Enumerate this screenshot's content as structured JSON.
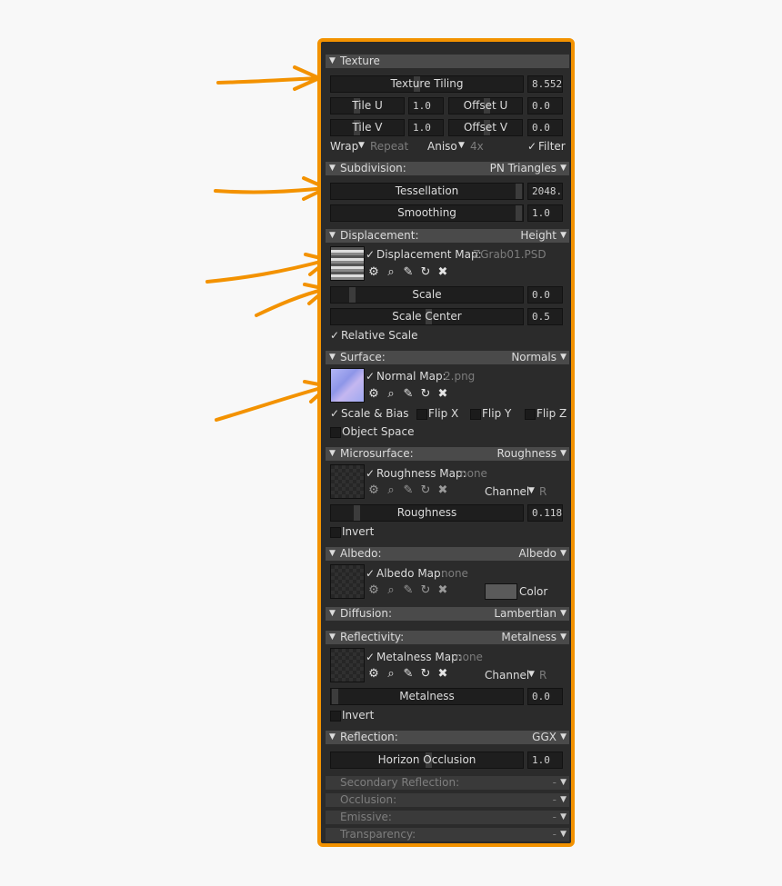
{
  "texture": {
    "header": "Texture",
    "tiling_label": "Texture Tiling",
    "tiling_value": "8.552",
    "tile_u_label": "Tile U",
    "tile_u_value": "1.0",
    "offset_u_label": "Offset U",
    "offset_u_value": "0.0",
    "tile_v_label": "Tile V",
    "tile_v_value": "1.0",
    "offset_v_label": "Offset V",
    "offset_v_value": "0.0",
    "wrap_label": "Wrap",
    "wrap_value": "Repeat",
    "aniso_label": "Aniso",
    "aniso_value": "4x",
    "filter_label": "Filter"
  },
  "subdivision": {
    "header": "Subdivision:",
    "mode": "PN Triangles",
    "tess_label": "Tessellation",
    "tess_value": "2048.",
    "smooth_label": "Smoothing",
    "smooth_value": "1.0"
  },
  "displacement": {
    "header": "Displacement:",
    "mode": "Height",
    "map_label": "Displacement Map:",
    "map_file": "ZGrab01.PSD",
    "scale_label": "Scale",
    "scale_value": "0.0",
    "center_label": "Scale Center",
    "center_value": "0.5",
    "relative_label": "Relative Scale"
  },
  "surface": {
    "header": "Surface:",
    "mode": "Normals",
    "map_label": "Normal Map:",
    "map_file": "2.png",
    "scale_bias_label": "Scale & Bias",
    "flip_x_label": "Flip X",
    "flip_y_label": "Flip Y",
    "flip_z_label": "Flip Z",
    "object_space_label": "Object Space"
  },
  "microsurface": {
    "header": "Microsurface:",
    "mode": "Roughness",
    "map_label": "Roughness Map:",
    "map_file": "none",
    "channel_label": "Channel",
    "channel_value": "R",
    "value_label": "Roughness",
    "value": "0.118",
    "invert_label": "Invert"
  },
  "albedo": {
    "header": "Albedo:",
    "mode": "Albedo",
    "map_label": "Albedo Map:",
    "map_file": "none",
    "color_label": "Color"
  },
  "diffusion": {
    "header": "Diffusion:",
    "mode": "Lambertian"
  },
  "reflectivity": {
    "header": "Reflectivity:",
    "mode": "Metalness",
    "map_label": "Metalness Map:",
    "map_file": "none",
    "channel_label": "Channel",
    "channel_value": "R",
    "value_label": "Metalness",
    "value": "0.0",
    "invert_label": "Invert"
  },
  "reflection": {
    "header": "Reflection:",
    "mode": "GGX",
    "horizon_label": "Horizon Occlusion",
    "horizon_value": "1.0"
  },
  "collapsed": [
    {
      "header": "Secondary Reflection:",
      "mode": "-"
    },
    {
      "header": "Occlusion:",
      "mode": "-"
    },
    {
      "header": "Emissive:",
      "mode": "-"
    },
    {
      "header": "Transparency:",
      "mode": "-"
    }
  ],
  "icons": {
    "settings": "gear-icon",
    "search": "magnifier-icon",
    "edit": "pencil-icon",
    "reload": "reload-icon",
    "clear": "close-icon",
    "check": "checkmark-icon",
    "collapse": "triangle-down-icon",
    "dropdown": "dropdown-icon"
  },
  "colors": {
    "accent": "#f39200",
    "panel_bg": "#2b2b2b",
    "header_bg": "#4a4a4a",
    "field_bg": "#1e1e1e"
  }
}
